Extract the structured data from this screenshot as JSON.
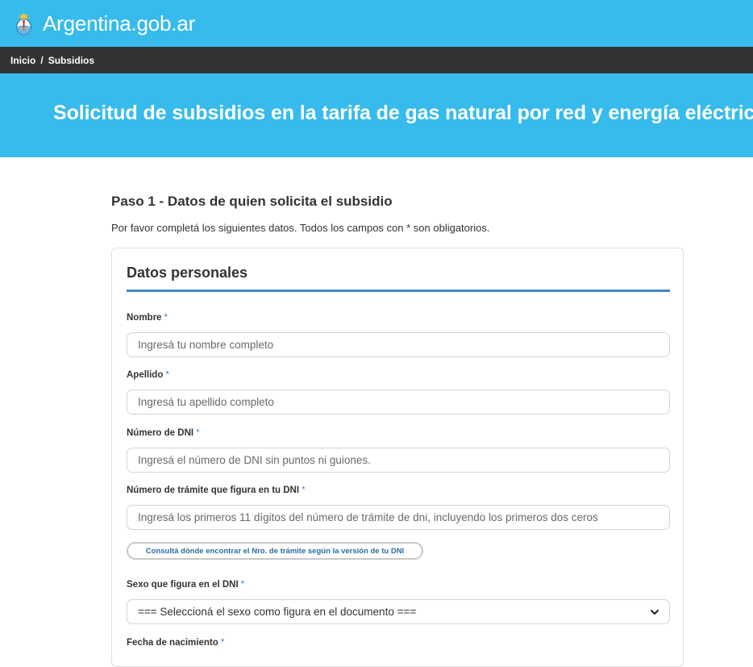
{
  "header": {
    "brand": "Argentina.gob.ar",
    "logo_icon": "argentina-coat-of-arms-icon",
    "bg_color": "#37bbed"
  },
  "breadcrumb": {
    "items": [
      "Inicio",
      "Subsidios"
    ],
    "separator": "/"
  },
  "hero": {
    "title": "Solicitud de subsidios en la tarifa de gas natural por red y energía eléctrica"
  },
  "step": {
    "title": "Paso 1 - Datos de quien solicita el subsidio",
    "description": "Por favor completá los siguientes datos. Todos los campos con * son obligatorios."
  },
  "card": {
    "title": "Datos personales",
    "accent_color": "#3f87c8",
    "required_mark": "*",
    "fields": [
      {
        "label": "Nombre",
        "placeholder": "Ingresá tu nombre completo"
      },
      {
        "label": "Apellido",
        "placeholder": "Ingresá tu apellido completo"
      },
      {
        "label": "Número de DNI",
        "placeholder": "Ingresá el número de DNI sin puntos ni guiones."
      },
      {
        "label": "Número de trámite que figura en tu DNI",
        "placeholder": "Ingresá los primeros 11 dígitos del número de trámite de dni, incluyendo los primeros dos ceros"
      }
    ],
    "help_button": "Consultá dónde encontrar el Nro. de trámite según la versión de tu DNI",
    "sex": {
      "label": "Sexo que figura en el DNI",
      "selected": "=== Seleccioná el sexo como figura en el documento ===",
      "icon": "chevron-down-icon"
    },
    "birthdate": {
      "label": "Fecha de nacimiento"
    }
  }
}
